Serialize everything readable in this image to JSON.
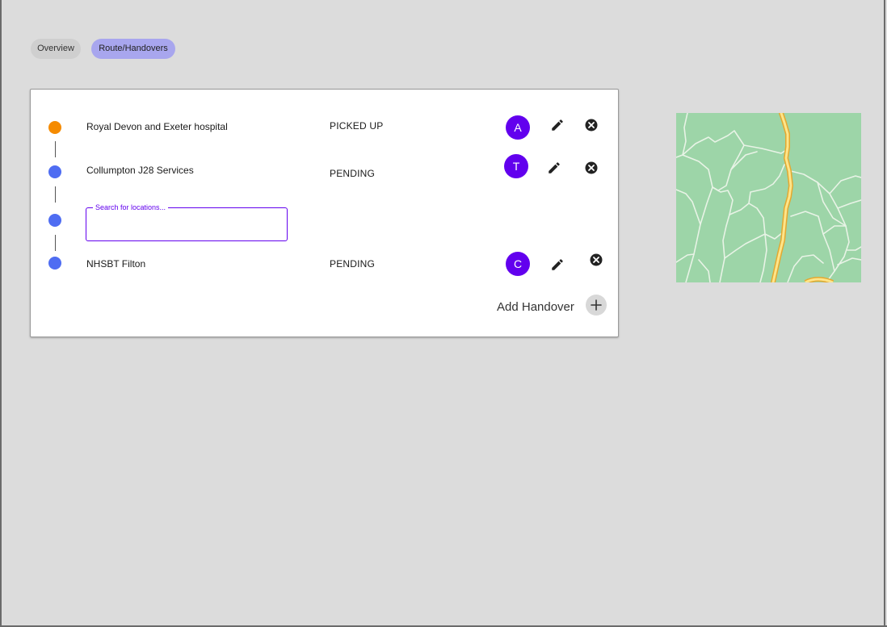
{
  "tabs": [
    {
      "label": "Overview",
      "active": false
    },
    {
      "label": "Route/Handovers",
      "active": true
    }
  ],
  "route": {
    "stops": [
      {
        "name": "Royal Devon and Exeter hospital",
        "status": "PICKED UP",
        "avatar": "A",
        "dot_color": "#f58b00"
      },
      {
        "name": "Collumpton J28 Services",
        "status": "PENDING",
        "avatar": "T",
        "dot_color": "#4f6df2"
      },
      {
        "search_label": "Search for locations...",
        "search_value": "",
        "dot_color": "#4f6df2"
      },
      {
        "name": "NHSBT Filton",
        "status": "PENDING",
        "avatar": "C",
        "dot_color": "#4f6df2"
      }
    ],
    "add_handover_label": "Add Handover"
  },
  "icons": {
    "edit": "pencil-icon",
    "remove": "close-circle-icon",
    "add": "plus-icon"
  },
  "colors": {
    "accent": "#6200ee",
    "active_tab": "#a8a6ee",
    "pending_dot": "#4f6df2",
    "picked_up_dot": "#f58b00",
    "map_land": "#9dd5a8",
    "map_road": "#f7c948"
  }
}
